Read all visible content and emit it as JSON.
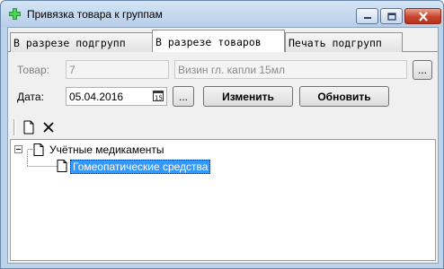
{
  "window": {
    "title": "Привязка товара к группам"
  },
  "tabs": [
    {
      "label": "В разрезе подгрупп",
      "active": false
    },
    {
      "label": "В разрезе товаров",
      "active": true
    },
    {
      "label": "Печать подгрупп",
      "active": false
    }
  ],
  "form": {
    "product_label": "Товар:",
    "product_code": "7",
    "product_name": "Визин гл. капли 15мл",
    "browse_label": "...",
    "date_label": "Дата:",
    "date_value": "05.04.2016",
    "date_browse_label": "...",
    "change_button": "Изменить",
    "refresh_button": "Обновить"
  },
  "tree": {
    "root": {
      "label": "Учётные медикаменты",
      "expander": "⊟"
    },
    "children": [
      {
        "label": "Гомеопатические средства",
        "selected": true
      }
    ]
  },
  "colors": {
    "selection": "#3399ff",
    "title_bar": "#bcd3ec"
  }
}
